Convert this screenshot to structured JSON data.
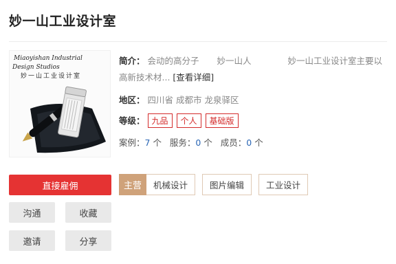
{
  "studio": {
    "name": "妙一山工业设计室"
  },
  "logo": {
    "line1": "Miaoyishan Industrial",
    "line2": "Design Studios",
    "line3": "妙一山工业设计室"
  },
  "intro": {
    "label": "简介：",
    "part1": "会动的高分子",
    "part2": "妙一山人",
    "part3": "妙一山工业设计室主要以",
    "line2": "高新技术材...",
    "more_link": "[查看详细]"
  },
  "region": {
    "label": "地区：",
    "value": "四川省 成都市 龙泉驿区"
  },
  "level": {
    "label": "等级：",
    "tags": [
      "九品",
      "个人",
      "基础版"
    ]
  },
  "stats": {
    "cases_label": "案例：",
    "cases_value": "7",
    "services_label": "服务：",
    "services_value": "0",
    "members_label": "成员：",
    "members_value": "0",
    "unit": "个"
  },
  "actions": {
    "hire": "直接雇佣",
    "talk": "沟通",
    "favorite": "收藏",
    "invite": "邀请",
    "share": "分享"
  },
  "skills": {
    "main_label": "主营",
    "items": [
      "机械设计",
      "图片编辑",
      "工业设计"
    ]
  },
  "colors": {
    "accent_red": "#e53333",
    "tag_red": "#d32a2a",
    "main_badge": "#cfa27a",
    "link_blue": "#2a66b5"
  }
}
